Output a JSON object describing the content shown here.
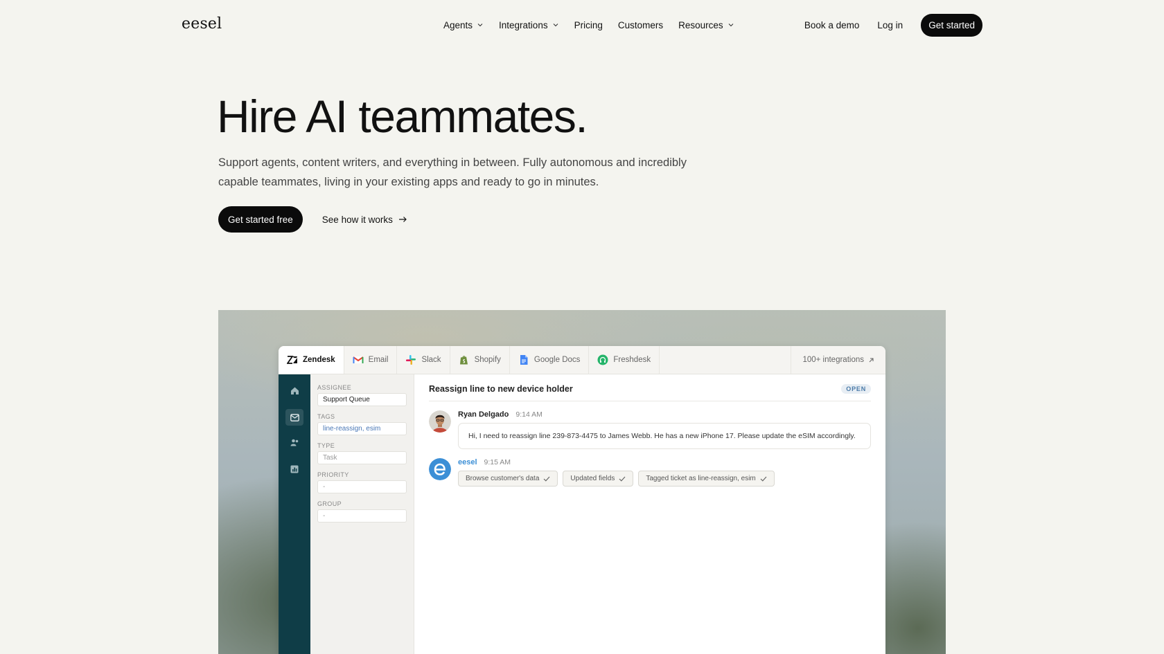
{
  "nav": {
    "logo": "eesel",
    "links": [
      {
        "label": "Agents",
        "dropdown": true
      },
      {
        "label": "Integrations",
        "dropdown": true
      },
      {
        "label": "Pricing",
        "dropdown": false
      },
      {
        "label": "Customers",
        "dropdown": false
      },
      {
        "label": "Resources",
        "dropdown": true
      }
    ],
    "book_demo": "Book a demo",
    "login": "Log in",
    "get_started": "Get started"
  },
  "hero": {
    "title": "Hire AI teammates.",
    "subtitle": "Support agents, content writers, and everything in between. Fully autonomous and incredibly capable teammates, living in your existing apps and ready to go in minutes.",
    "cta_primary": "Get started free",
    "cta_secondary": "See how it works"
  },
  "demo": {
    "tabs": [
      {
        "label": "Zendesk",
        "icon": "zendesk-icon",
        "active": true
      },
      {
        "label": "Email",
        "icon": "gmail-icon",
        "active": false
      },
      {
        "label": "Slack",
        "icon": "slack-icon",
        "active": false
      },
      {
        "label": "Shopify",
        "icon": "shopify-icon",
        "active": false
      },
      {
        "label": "Google Docs",
        "icon": "google-docs-icon",
        "active": false
      },
      {
        "label": "Freshdesk",
        "icon": "freshdesk-icon",
        "active": false
      }
    ],
    "integrations_link": "100+ integrations",
    "rail_icons": [
      "home-icon",
      "inbox-icon",
      "users-icon",
      "chart-icon"
    ],
    "fields": {
      "assignee_label": "ASSIGNEE",
      "assignee_value": "Support Queue",
      "tags_label": "TAGS",
      "tags_value": "line-reassign, esim",
      "type_label": "TYPE",
      "type_value": "Task",
      "priority_label": "PRIORITY",
      "priority_value": "-",
      "group_label": "GROUP",
      "group_value": "-"
    },
    "ticket": {
      "title": "Reassign line to new device holder",
      "status": "OPEN"
    },
    "message": {
      "name": "Ryan Delgado",
      "time": "9:14 AM",
      "text": "Hi, I need to reassign line 239-873-4475 to James Webb. He has a new iPhone 17. Please update the eSIM accordingly."
    },
    "reply": {
      "name": "eesel",
      "time": "9:15 AM",
      "actions": [
        "Browse customer's data",
        "Updated fields",
        "Tagged ticket as line-reassign, esim"
      ]
    }
  },
  "colors": {
    "page_bg": "#f4f4ef",
    "dark_button": "#0b0b0b",
    "rail": "#0f3d47",
    "accent_blue": "#3c8fd6"
  }
}
